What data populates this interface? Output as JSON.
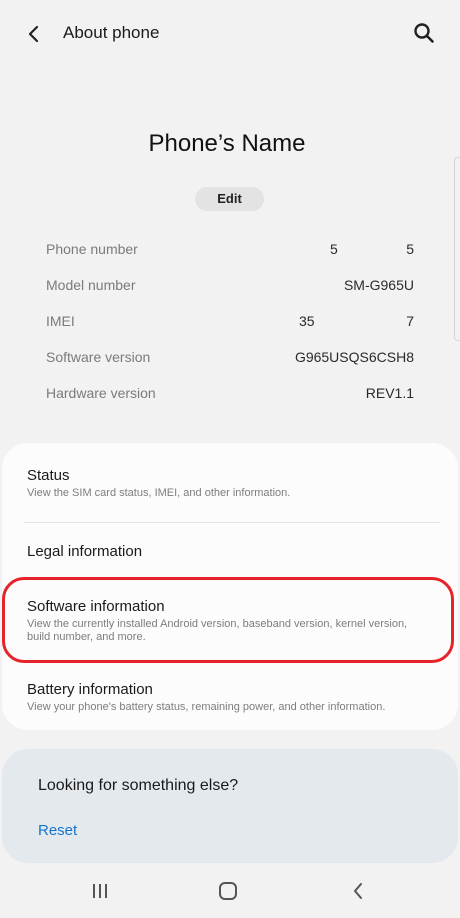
{
  "header": {
    "title": "About phone",
    "back_icon": "back-arrow-icon",
    "search_icon": "search-icon"
  },
  "device": {
    "name": "Phone’s Name",
    "edit_label": "Edit"
  },
  "info": [
    {
      "label": "Phone number",
      "value_a": "5",
      "value_b": "5"
    },
    {
      "label": "Model number",
      "value": "SM-G965U"
    },
    {
      "label": "IMEI",
      "value_a": "35",
      "value_b": "7"
    },
    {
      "label": "Software version",
      "value": "G965USQS6CSH8"
    },
    {
      "label": "Hardware version",
      "value": "REV1.1"
    }
  ],
  "menu": {
    "status": {
      "title": "Status",
      "subtitle": "View the SIM card status, IMEI, and other information."
    },
    "legal": {
      "title": "Legal information"
    },
    "software": {
      "title": "Software information",
      "subtitle": "View the currently installed Android version, baseband version, kernel version, build number, and more."
    },
    "battery": {
      "title": "Battery information",
      "subtitle": "View your phone's battery status, remaining power, and other information."
    }
  },
  "suggest": {
    "title": "Looking for something else?",
    "reset_label": "Reset"
  },
  "navbar": {
    "recents_icon": "recents-icon",
    "home_icon": "home-icon",
    "back_icon": "back-icon"
  },
  "colors": {
    "background": "#f2f2f2",
    "card": "#fcfcfc",
    "highlight": "#e5232b",
    "link": "#1873cd",
    "suggest_bg": "#e4e9ee"
  }
}
